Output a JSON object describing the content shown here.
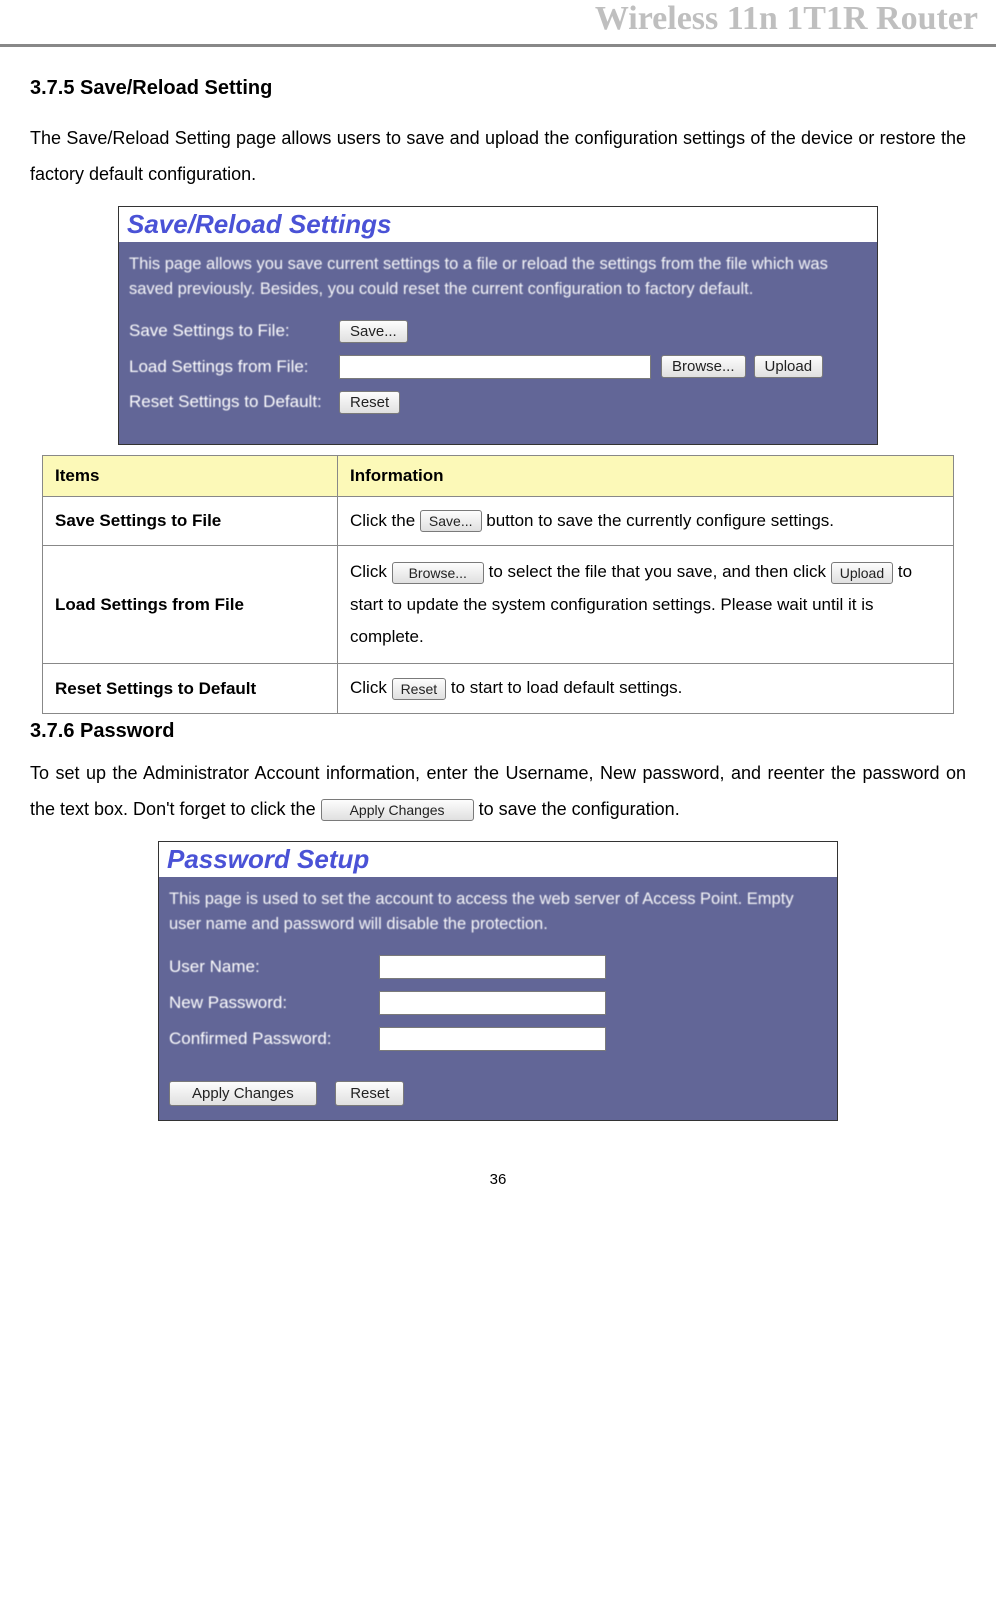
{
  "header": {
    "title": "Wireless 11n 1T1R Router"
  },
  "section1": {
    "heading": "3.7.5 Save/Reload Setting",
    "intro": "The Save/Reload Setting page allows users to save and upload the configuration settings of the device or restore the factory default configuration."
  },
  "screenshot1": {
    "title": "Save/Reload Settings",
    "desc": "This page allows you save current settings to a file or reload the settings from the file which was saved previously. Besides, you could reset the current configuration to factory default.",
    "row1_label": "Save Settings to File:",
    "row1_btn": "Save...",
    "row2_label": "Load Settings from File:",
    "row2_btn_browse": "Browse...",
    "row2_btn_upload": "Upload",
    "row3_label": "Reset Settings to Default:",
    "row3_btn": "Reset"
  },
  "table": {
    "header_items": "Items",
    "header_info": "Information",
    "rows": [
      {
        "item": "Save Settings to File",
        "p1": "Click the ",
        "btn1": "Save...",
        "p2": " button to save the currently configure settings."
      },
      {
        "item": "Load Settings from File",
        "p1": "Click ",
        "btn1": "Browse...",
        "p2": " to select the file that you save, and then click ",
        "btn2": "Upload",
        "p3": " to start to update the system configuration settings. Please wait until it is complete."
      },
      {
        "item": "Reset Settings to Default",
        "p1": "Click ",
        "btn1": "Reset",
        "p2": " to start to load default settings."
      }
    ]
  },
  "section2": {
    "heading": "3.7.6 Password",
    "p1": "To set up the Administrator Account information, enter the Username, New password, and reenter the password on the text box. Don't forget to click the ",
    "btn": "Apply Changes",
    "p2": " to save the configuration."
  },
  "screenshot2": {
    "title": "Password Setup",
    "desc": "This page is used to set the account to access the web server of Access Point. Empty user name and password will disable the protection.",
    "row1_label": "User Name:",
    "row2_label": "New Password:",
    "row3_label": "Confirmed Password:",
    "btn_apply": "Apply Changes",
    "btn_reset": "Reset"
  },
  "page_number": "36"
}
